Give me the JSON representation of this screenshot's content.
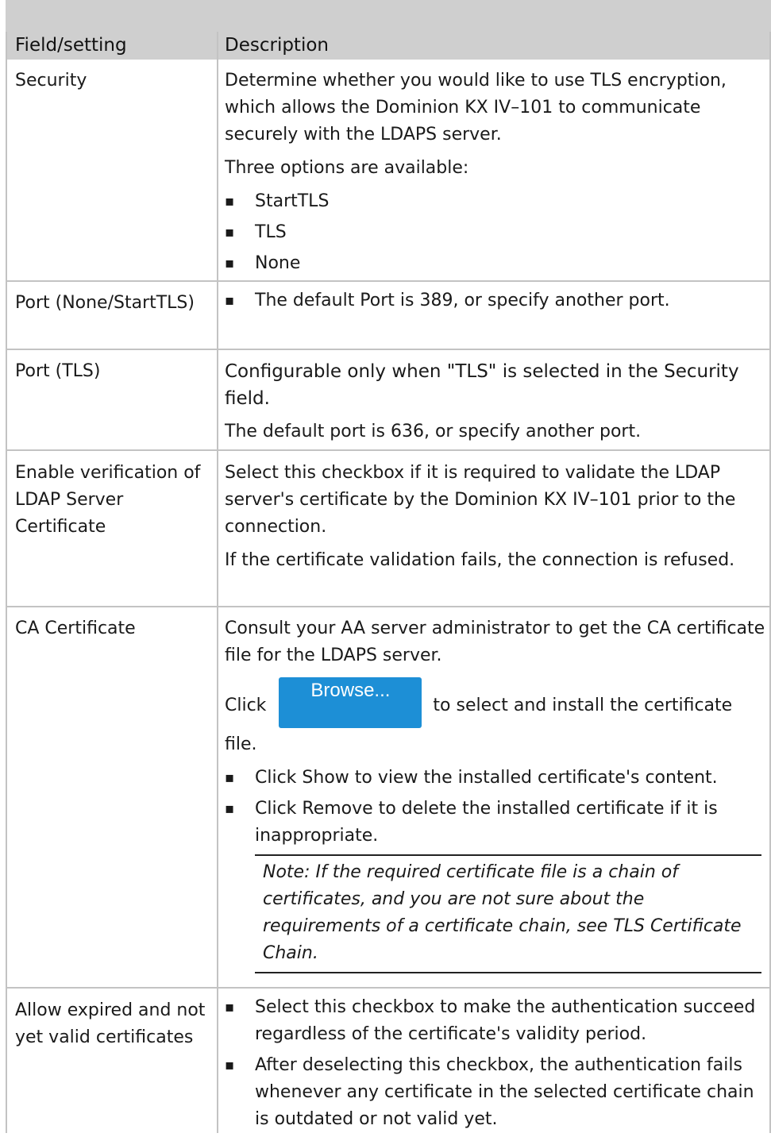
{
  "header": {
    "col1": "Field/setting",
    "col2": "Description"
  },
  "rows": {
    "security": {
      "field": "Security",
      "desc": "Determine whether you would like to use TLS encryption, which allows the Dominion KX IV–101 to communicate securely with the LDAPS server.",
      "options_intro": "Three options are available:",
      "options": [
        "StartTLS",
        "TLS",
        "None"
      ]
    },
    "port": {
      "field": "Port (None/StartTLS)",
      "bullet": "The default Port is 389, or specify another port."
    },
    "port_tls": {
      "field": "Port (TLS)",
      "strong": "Configurable only when \"TLS\" is selected in the Security field.",
      "desc": "The default port is 636, or specify another port."
    },
    "verify": {
      "field": "Enable verification of LDAP Server Certificate",
      "desc1": "Select this checkbox if it is required to validate the LDAP server's certificate by the Dominion KX IV–101 prior to the connection.",
      "desc2": "If the certificate validation fails, the connection is refused."
    },
    "ca": {
      "field": "CA Certificate",
      "desc": "Consult your AA server administrator to get the CA certificate file for the LDAPS server.",
      "click_prefix": "Click",
      "browse_label": "Browse...",
      "click_suffix": "to select and install the certificate file.",
      "bullets": [
        "Click Show to view the installed certificate's content.",
        "Click Remove to delete the installed certificate if it is inappropriate."
      ],
      "note": "Note: If the required certificate file is a chain of certificates, and you are not sure about the requirements of a certificate chain, see TLS Certificate Chain."
    },
    "expired": {
      "field": "Allow expired and not yet valid certificates",
      "bullets": [
        "Select this checkbox to make the authentication succeed regardless of the certificate's validity period.",
        "After deselecting this checkbox, the authentication fails whenever any certificate in the selected certificate chain is outdated or not valid yet."
      ]
    }
  }
}
